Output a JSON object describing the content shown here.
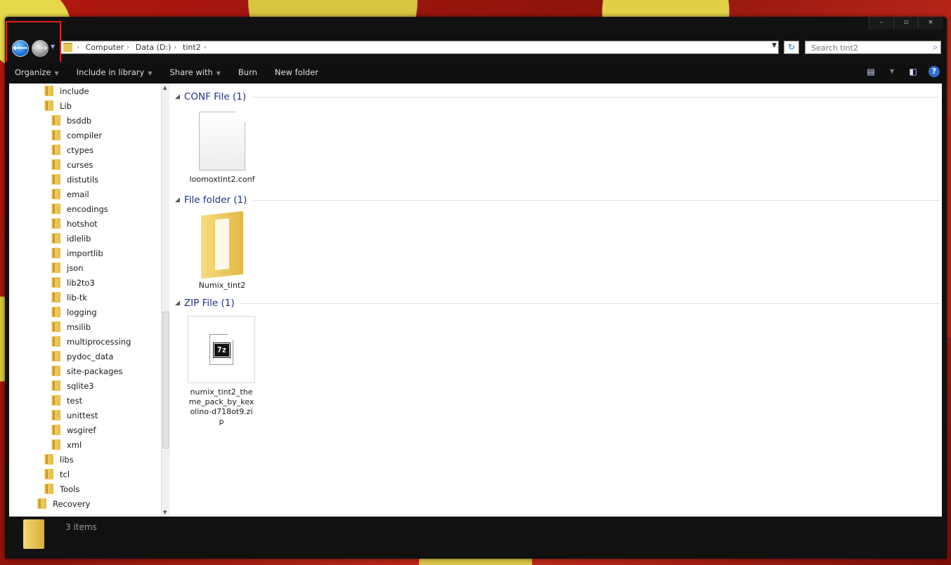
{
  "window": {
    "caption_buttons": {
      "minimize": "–",
      "maximize": "▫",
      "close": "×"
    }
  },
  "nav": {
    "back_glyph": "⟵",
    "forward_glyph": "⟶",
    "recent_glyph": "▼"
  },
  "address": {
    "breadcrumbs": [
      "Computer",
      "Data (D:)",
      "tint2"
    ],
    "separator": "›",
    "dropdown_glyph": "▼",
    "refresh_glyph": "↻"
  },
  "search": {
    "placeholder": "Search tint2",
    "icon": "search-icon"
  },
  "toolbar": {
    "items": [
      {
        "label": "Organize",
        "has_dropdown": true
      },
      {
        "label": "Include in library",
        "has_dropdown": true
      },
      {
        "label": "Share with",
        "has_dropdown": true
      },
      {
        "label": "Burn",
        "has_dropdown": false
      },
      {
        "label": "New folder",
        "has_dropdown": false
      }
    ],
    "dropdown_glyph": "▼",
    "view_glyph": "▤",
    "preview_glyph": "◧",
    "help_glyph": "?"
  },
  "nav_tree": [
    {
      "label": "include",
      "indent": 1
    },
    {
      "label": "Lib",
      "indent": 1
    },
    {
      "label": "bsddb",
      "indent": 2
    },
    {
      "label": "compiler",
      "indent": 2
    },
    {
      "label": "ctypes",
      "indent": 2
    },
    {
      "label": "curses",
      "indent": 2
    },
    {
      "label": "distutils",
      "indent": 2
    },
    {
      "label": "email",
      "indent": 2
    },
    {
      "label": "encodings",
      "indent": 2
    },
    {
      "label": "hotshot",
      "indent": 2
    },
    {
      "label": "idlelib",
      "indent": 2
    },
    {
      "label": "importlib",
      "indent": 2
    },
    {
      "label": "json",
      "indent": 2
    },
    {
      "label": "lib2to3",
      "indent": 2
    },
    {
      "label": "lib-tk",
      "indent": 2
    },
    {
      "label": "logging",
      "indent": 2
    },
    {
      "label": "msilib",
      "indent": 2
    },
    {
      "label": "multiprocessing",
      "indent": 2
    },
    {
      "label": "pydoc_data",
      "indent": 2
    },
    {
      "label": "site-packages",
      "indent": 2
    },
    {
      "label": "sqlite3",
      "indent": 2
    },
    {
      "label": "test",
      "indent": 2
    },
    {
      "label": "unittest",
      "indent": 2
    },
    {
      "label": "wsgiref",
      "indent": 2
    },
    {
      "label": "xml",
      "indent": 2
    },
    {
      "label": "libs",
      "indent": 1
    },
    {
      "label": "tcl",
      "indent": 1
    },
    {
      "label": "Tools",
      "indent": 1
    },
    {
      "label": "Recovery",
      "indent": 0
    }
  ],
  "groups": [
    {
      "header": "CONF File (1)",
      "files": [
        {
          "name": "loomoxtint2.conf",
          "icon": "document-icon"
        }
      ]
    },
    {
      "header": "File folder (1)",
      "files": [
        {
          "name": "Numix_tint2",
          "icon": "folder-icon"
        }
      ]
    },
    {
      "header": "ZIP File (1)",
      "files": [
        {
          "name": "numix_tint2_theme_pack_by_kexolino-d718ot9.zip",
          "icon": "7z-archive-icon",
          "badge": "7z"
        }
      ]
    }
  ],
  "group_collapse_glyph": "◢",
  "status": {
    "item_count": "3 items"
  },
  "colors": {
    "group_header": "#1e3287",
    "selection_box": "#e02020",
    "toolbar_bg": "#101010"
  }
}
